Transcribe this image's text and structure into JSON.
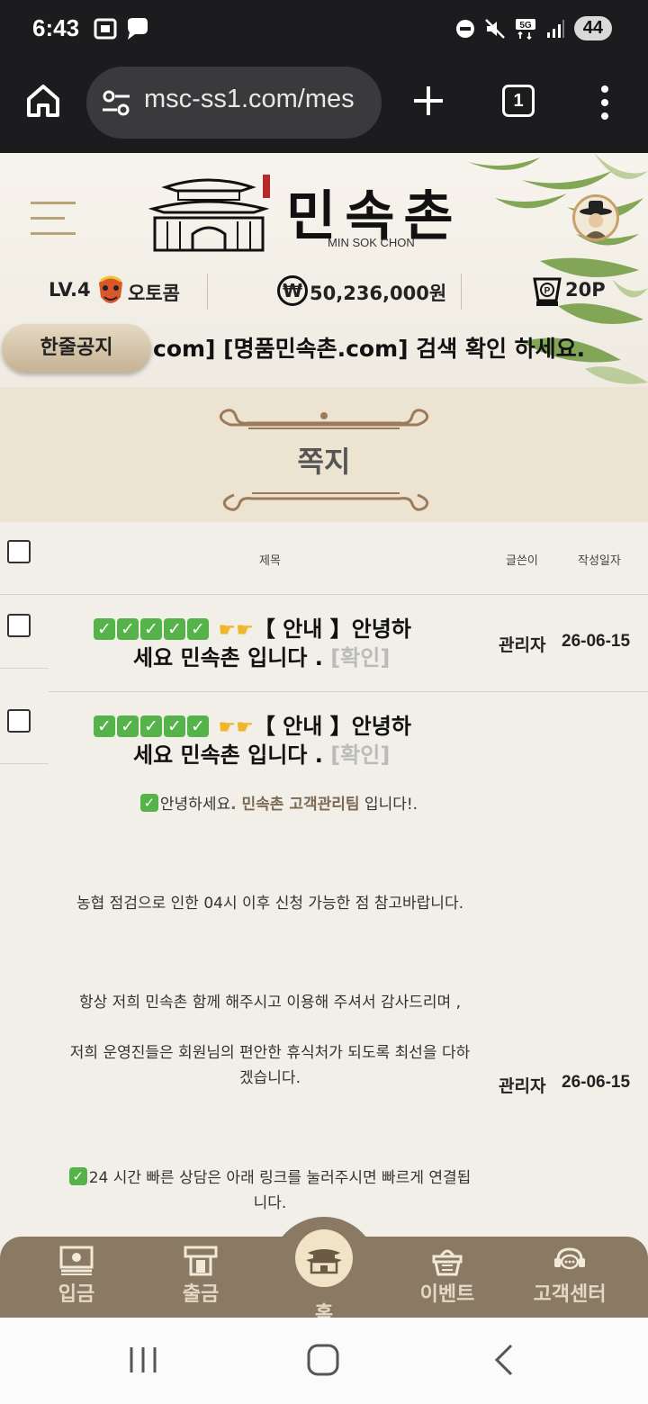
{
  "status_bar": {
    "time": "6:43",
    "battery": "44"
  },
  "browser": {
    "url": "msc-ss1.com/mes",
    "tab_count": "1"
  },
  "site": {
    "logo_text": "민속촌",
    "logo_sub": "MIN SOK CHON",
    "level": "LV.4",
    "nickname": "오토콤",
    "money": "50,236,000원",
    "points": "20P",
    "notice_label": "한줄공지",
    "notice_text": "com] [명품민속촌.com] 검색 확인 하세요."
  },
  "page": {
    "title": "쪽지"
  },
  "table": {
    "headers": {
      "subject": "제목",
      "author": "글쓴이",
      "date": "작성일자"
    },
    "rows": [
      {
        "subject_line1": "【 안내 】안녕하",
        "subject_line2": "세요 민속촌 입니다 .",
        "confirm": "[확인]",
        "author": "관리자",
        "date": "26-06-15"
      },
      {
        "subject_line1": "【 안내 】안녕하",
        "subject_line2": "세요 민속촌 입니다 .",
        "confirm": "[확인]",
        "author": "관리자",
        "date": "26-06-15",
        "body": {
          "greeting_pre": "안녕하세요",
          "greeting_highlight": ". 민속촌 고객관리팀",
          "greeting_post": " 입니다!.",
          "line2": "농협 점검으로 인한 04시 이후 신청 가능한 점 참고바랍니다.",
          "line3": "항상 저희 민속촌 함께 해주시고 이용해 주셔서 감사드리며 ,",
          "line4a": "저희 운영진들은 회원님의 편안한 휴식처가 되도록 최선을 다하",
          "line4b": "겠습니다.",
          "line5a": "24 시간 빠른 상담은 아래 링크를 눌러주시면 빠르게 연결됩",
          "line5b": "니다."
        }
      }
    ]
  },
  "bottom_nav": [
    {
      "label": "입금",
      "icon": "deposit-icon"
    },
    {
      "label": "출금",
      "icon": "withdraw-icon"
    },
    {
      "label": "홈",
      "icon": "home-building-icon"
    },
    {
      "label": "이벤트",
      "icon": "event-basket-icon"
    },
    {
      "label": "고객센터",
      "icon": "support-chat-icon"
    }
  ]
}
